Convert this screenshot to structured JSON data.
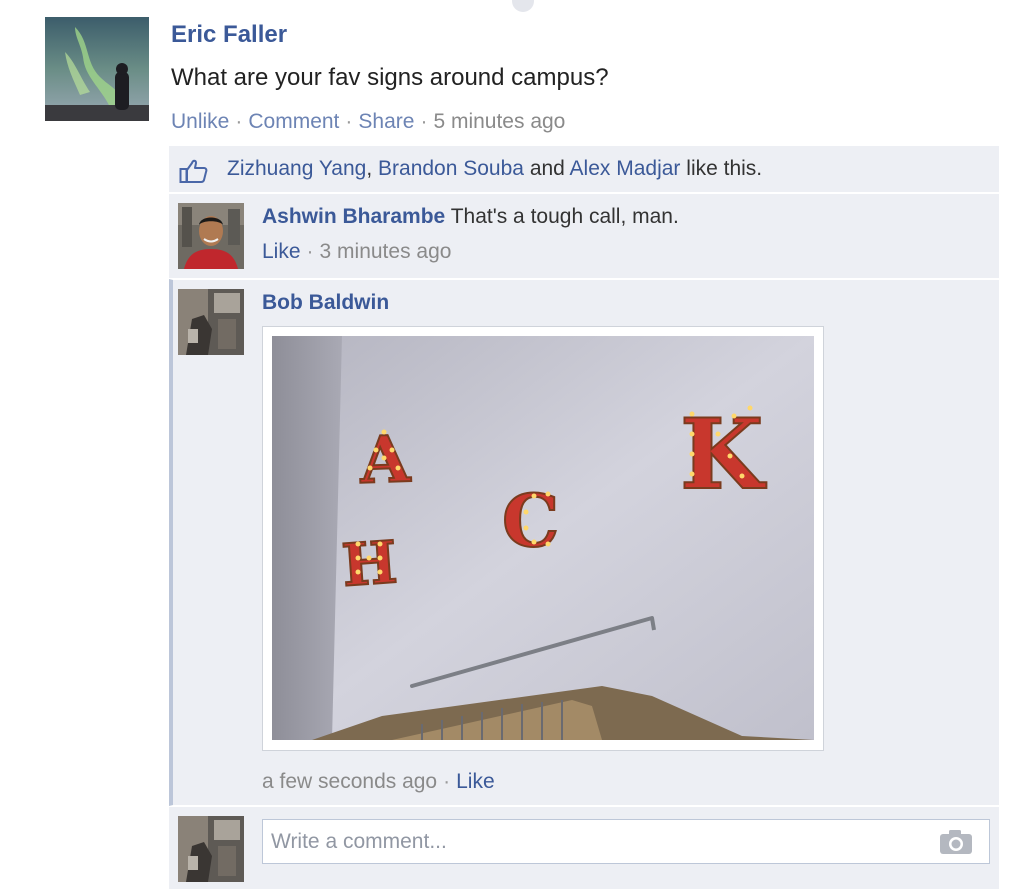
{
  "post": {
    "author": "Eric Faller",
    "text": "What are your fav signs around campus?",
    "actions": {
      "unlike": "Unlike",
      "comment": "Comment",
      "share": "Share",
      "time": "5 minutes ago",
      "separator": "·"
    }
  },
  "likes": {
    "names": [
      "Zizhuang Yang",
      "Brandon Souba",
      "Alex Madjar"
    ],
    "comma": ", ",
    "and_text": " and ",
    "suffix": " like this."
  },
  "comments": [
    {
      "author": "Ashwin Bharambe",
      "text": "That's a tough call, man.",
      "like_label": "Like",
      "time": "3 minutes ago"
    },
    {
      "author": "Bob Baldwin",
      "time": "a few seconds ago",
      "like_label": "Like",
      "photo_letters": [
        "H",
        "A",
        "C",
        "K"
      ]
    }
  ],
  "composer": {
    "placeholder": "Write a comment..."
  },
  "icons": {
    "like": "thumbs-up-icon",
    "camera": "camera-icon"
  },
  "colors": {
    "link": "#3b5998",
    "ufi_background": "#edeff4",
    "muted": "#8a8a8a"
  }
}
